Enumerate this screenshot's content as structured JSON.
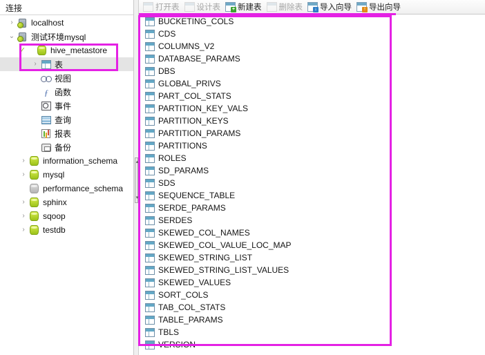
{
  "window": {
    "app": "Navicat-style database manager"
  },
  "sidebar": {
    "header": "连接",
    "items": [
      {
        "label": "localhost",
        "icon": "server-icon",
        "chevron": "›",
        "indent": 0,
        "checked": false,
        "selected": false,
        "dim": false
      },
      {
        "label": "测试环境mysql",
        "icon": "server-icon",
        "chevron": "⌄",
        "indent": 0,
        "checked": false,
        "selected": false,
        "dim": false
      },
      {
        "label": "hive_metastore",
        "icon": "database-icon",
        "chevron": "",
        "indent": 1,
        "checked": true,
        "selected": false,
        "dim": false
      },
      {
        "label": "表",
        "icon": "table-icon",
        "chevron": "›",
        "indent": 2,
        "checked": false,
        "selected": true,
        "dim": false
      },
      {
        "label": "视图",
        "icon": "view-icon",
        "chevron": "",
        "indent": 2,
        "checked": false,
        "selected": false,
        "dim": false
      },
      {
        "label": "函数",
        "icon": "function-icon",
        "chevron": "",
        "indent": 2,
        "checked": false,
        "selected": false,
        "dim": false
      },
      {
        "label": "事件",
        "icon": "event-icon",
        "chevron": "",
        "indent": 2,
        "checked": false,
        "selected": false,
        "dim": false
      },
      {
        "label": "查询",
        "icon": "query-icon",
        "chevron": "",
        "indent": 2,
        "checked": false,
        "selected": false,
        "dim": false
      },
      {
        "label": "报表",
        "icon": "report-icon",
        "chevron": "",
        "indent": 2,
        "checked": false,
        "selected": false,
        "dim": false
      },
      {
        "label": "备份",
        "icon": "backup-icon",
        "chevron": "",
        "indent": 2,
        "checked": false,
        "selected": false,
        "dim": false
      },
      {
        "label": "information_schema",
        "icon": "database-icon",
        "chevron": "›",
        "indent": 1,
        "checked": false,
        "selected": false,
        "dim": false
      },
      {
        "label": "mysql",
        "icon": "database-icon",
        "chevron": "›",
        "indent": 1,
        "checked": false,
        "selected": false,
        "dim": false
      },
      {
        "label": "performance_schema",
        "icon": "database-icon",
        "chevron": "",
        "indent": 1,
        "checked": false,
        "selected": false,
        "dim": true
      },
      {
        "label": "sphinx",
        "icon": "database-icon",
        "chevron": "›",
        "indent": 1,
        "checked": false,
        "selected": false,
        "dim": false
      },
      {
        "label": "sqoop",
        "icon": "database-icon",
        "chevron": "›",
        "indent": 1,
        "checked": false,
        "selected": false,
        "dim": false
      },
      {
        "label": "testdb",
        "icon": "database-icon",
        "chevron": "›",
        "indent": 1,
        "checked": false,
        "selected": false,
        "dim": false
      }
    ]
  },
  "toolbar": {
    "buttons": [
      {
        "label": "打开表",
        "icon": "open-table-icon",
        "badge": "",
        "badge_color": "dimb",
        "disabled": true
      },
      {
        "label": "设计表",
        "icon": "design-table-icon",
        "badge": "",
        "badge_color": "dimb",
        "disabled": true
      },
      {
        "label": "新建表",
        "icon": "new-table-icon",
        "badge": "+",
        "badge_color": "green",
        "disabled": false
      },
      {
        "label": "删除表",
        "icon": "delete-table-icon",
        "badge": "",
        "badge_color": "dimb",
        "disabled": true
      },
      {
        "label": "导入向导",
        "icon": "import-wizard-icon",
        "badge": "↓",
        "badge_color": "blue",
        "disabled": false
      },
      {
        "label": "导出向导",
        "icon": "export-wizard-icon",
        "badge": "↑",
        "badge_color": "orange",
        "disabled": false
      }
    ]
  },
  "table_list": {
    "icon": "table-icon",
    "items": [
      "BUCKETING_COLS",
      "CDS",
      "COLUMNS_V2",
      "DATABASE_PARAMS",
      "DBS",
      "GLOBAL_PRIVS",
      "PART_COL_STATS",
      "PARTITION_KEY_VALS",
      "PARTITION_KEYS",
      "PARTITION_PARAMS",
      "PARTITIONS",
      "ROLES",
      "SD_PARAMS",
      "SDS",
      "SEQUENCE_TABLE",
      "SERDE_PARAMS",
      "SERDES",
      "SKEWED_COL_NAMES",
      "SKEWED_COL_VALUE_LOC_MAP",
      "SKEWED_STRING_LIST",
      "SKEWED_STRING_LIST_VALUES",
      "SKEWED_VALUES",
      "SORT_COLS",
      "TAB_COL_STATS",
      "TABLE_PARAMS",
      "TBLS",
      "VERSION"
    ]
  },
  "annotations": {
    "highlight_color": "#e421e4",
    "boxes": [
      {
        "name": "table-list-highlight"
      },
      {
        "name": "tree-selection-highlight"
      },
      {
        "name": "toolbar-underline-highlight"
      }
    ]
  },
  "splitter": {
    "up_arrow": "▴",
    "down_arrow": "▾"
  }
}
